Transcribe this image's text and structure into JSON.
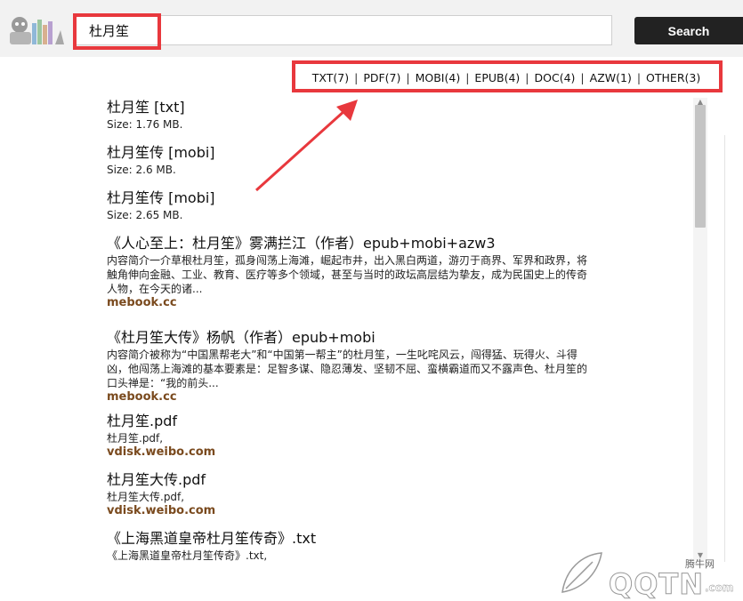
{
  "search": {
    "value": "杜月笙",
    "button_label": "Search"
  },
  "filters": [
    {
      "label": "TXT(7)"
    },
    {
      "label": "PDF(7)"
    },
    {
      "label": "MOBI(4)"
    },
    {
      "label": "EPUB(4)"
    },
    {
      "label": "DOC(4)"
    },
    {
      "label": "AZW(1)"
    },
    {
      "label": "OTHER(3)"
    }
  ],
  "filter_separator": "|",
  "results": [
    {
      "title": "杜月笙 [txt]",
      "lines": [
        "Size: 1.76 MB."
      ],
      "source": ""
    },
    {
      "title": "杜月笙传 [mobi]",
      "lines": [
        "Size: 2.6 MB."
      ],
      "source": ""
    },
    {
      "title": "杜月笙传 [mobi]",
      "lines": [
        "Size: 2.65 MB."
      ],
      "source": ""
    },
    {
      "title": "《人心至上：杜月笙》雾满拦江（作者）epub+mobi+azw3",
      "lines": [
        "内容简介一介草根杜月笙，孤身闯荡上海滩，崛起市井，出入黑白两道，游刃于商界、军界和政界，将",
        "触角伸向金融、工业、教育、医疗等多个领域，甚至与当时的政坛高层结为挚友，成为民国史上的传奇",
        "人物，在今天的诸..."
      ],
      "source": "mebook.cc"
    },
    {
      "title": "《杜月笙大传》杨帆（作者）epub+mobi",
      "lines": [
        "内容简介被称为“中国黑帮老大”和“中国第一帮主”的杜月笙，一生叱咤风云，闯得猛、玩得火、斗得",
        "凶，他闯荡上海滩的基本要素是：足智多谋、隐忍薄发、坚韧不屈、蛮横霸道而又不露声色、杜月笙的",
        "口头禅是：“我的前头..."
      ],
      "source": "mebook.cc"
    },
    {
      "title": "杜月笙.pdf",
      "lines": [
        "杜月笙.pdf,"
      ],
      "source": "vdisk.weibo.com"
    },
    {
      "title": "杜月笙大传.pdf",
      "lines": [
        "杜月笙大传.pdf,"
      ],
      "source": "vdisk.weibo.com"
    },
    {
      "title": "《上海黑道皇帝杜月笙传奇》.txt",
      "lines": [
        "《上海黑道皇帝杜月笙传奇》.txt,"
      ],
      "source": ""
    }
  ],
  "watermark": {
    "text": "腾牛网",
    "logo": "QQTN",
    "suffix": ".com"
  },
  "colors": {
    "highlight": "#e8383d",
    "source_link": "#7a4a1e",
    "button": "#222222"
  }
}
